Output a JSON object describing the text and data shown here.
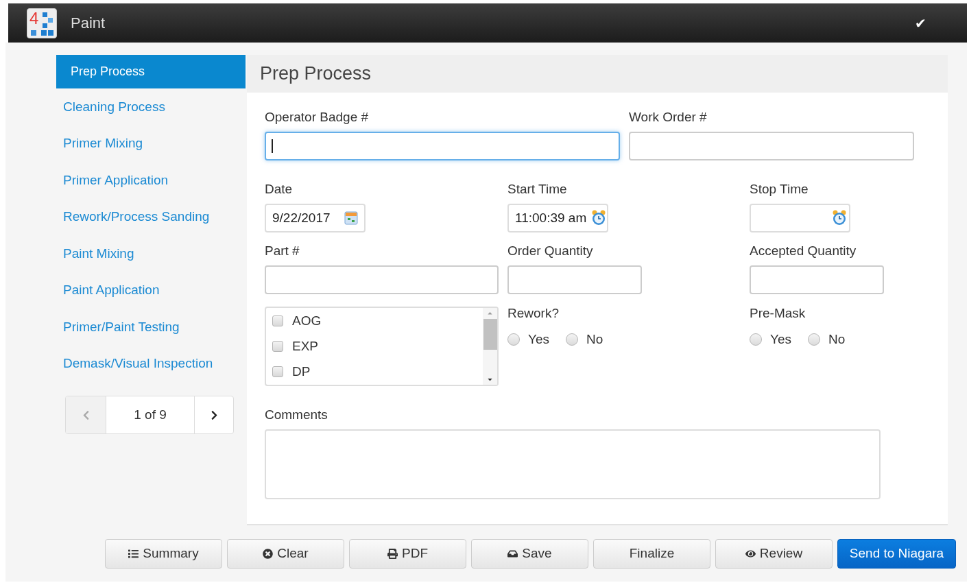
{
  "header": {
    "logo_text": "4",
    "title": "Paint",
    "check": "✔"
  },
  "sidebar": {
    "items": [
      {
        "label": "Prep Process",
        "selected": true
      },
      {
        "label": "Cleaning Process",
        "selected": false
      },
      {
        "label": "Primer Mixing",
        "selected": false
      },
      {
        "label": "Primer Application",
        "selected": false
      },
      {
        "label": "Rework/Process Sanding",
        "selected": false
      },
      {
        "label": "Paint Mixing",
        "selected": false
      },
      {
        "label": "Paint Application",
        "selected": false
      },
      {
        "label": "Primer/Paint Testing",
        "selected": false
      },
      {
        "label": "Demask/Visual Inspection",
        "selected": false
      }
    ],
    "pager": {
      "text": "1 of 9",
      "prev_disabled": true,
      "next_disabled": false
    }
  },
  "panel": {
    "title": "Prep Process",
    "operator_badge": {
      "label": "Operator Badge #",
      "focused": true
    },
    "work_order": {
      "label": "Work Order #",
      "focused": false
    },
    "date": {
      "label": "Date",
      "value": "9/22/2017"
    },
    "start_time": {
      "label": "Start Time",
      "value": "11:00:39 am"
    },
    "stop_time": {
      "label": "Stop Time"
    },
    "part": {
      "label": "Part #"
    },
    "order_quantity": {
      "label": "Order Quantity"
    },
    "accepted_quantity": {
      "label": "Accepted Quantity"
    },
    "flags": [
      {
        "label": "AOG",
        "checked": false
      },
      {
        "label": "EXP",
        "checked": false
      },
      {
        "label": "DP",
        "checked": false
      }
    ],
    "rework": {
      "label": "Rework?",
      "options": [
        {
          "label": "Yes",
          "selected": false
        },
        {
          "label": "No",
          "selected": false
        }
      ]
    },
    "pre_mask": {
      "label": "Pre-Mask",
      "options": [
        {
          "label": "Yes",
          "selected": false
        },
        {
          "label": "No",
          "selected": false
        }
      ]
    },
    "comments": {
      "label": "Comments"
    }
  },
  "buttons": [
    {
      "label": "Summary",
      "kind": "default"
    },
    {
      "label": "Clear",
      "kind": "default"
    },
    {
      "label": "PDF",
      "kind": "default"
    },
    {
      "label": "Save",
      "kind": "default"
    },
    {
      "label": "Finalize",
      "kind": "default"
    },
    {
      "label": "Review",
      "kind": "default"
    },
    {
      "label": "Send to Niagara",
      "kind": "primary"
    }
  ]
}
